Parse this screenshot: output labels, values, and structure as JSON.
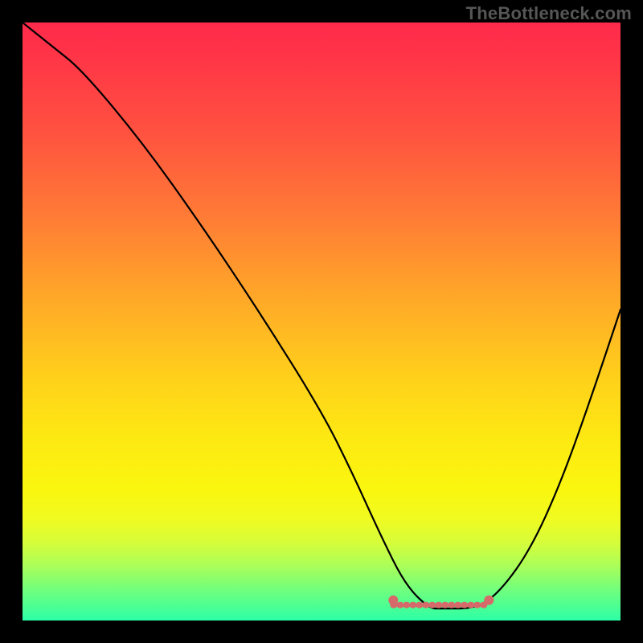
{
  "watermark": "TheBottleneck.com",
  "chart_data": {
    "type": "line",
    "title": "",
    "xlabel": "",
    "ylabel": "",
    "xlim": [
      0,
      100
    ],
    "ylim": [
      0,
      100
    ],
    "grid": false,
    "series": [
      {
        "name": "curve",
        "color": "#000000",
        "x": [
          0,
          5,
          10,
          20,
          30,
          40,
          50,
          55,
          60,
          64,
          68,
          70,
          76,
          80,
          85,
          90,
          95,
          100
        ],
        "values": [
          100,
          96,
          92,
          80,
          66,
          51,
          35,
          25,
          14,
          6,
          2,
          2,
          2,
          5,
          12,
          23,
          37,
          52
        ]
      }
    ],
    "highlight": {
      "name": "bottom-segment",
      "color": "#d66a6a",
      "x_start": 62,
      "x_end": 78,
      "y": 2.6
    },
    "gradient_stops": [
      {
        "pos": 0.0,
        "color": "#ff2a4b"
      },
      {
        "pos": 0.18,
        "color": "#ff5140"
      },
      {
        "pos": 0.46,
        "color": "#ffa828"
      },
      {
        "pos": 0.7,
        "color": "#fdea12"
      },
      {
        "pos": 0.87,
        "color": "#d6fd3a"
      },
      {
        "pos": 1.0,
        "color": "#2dffa6"
      }
    ]
  }
}
